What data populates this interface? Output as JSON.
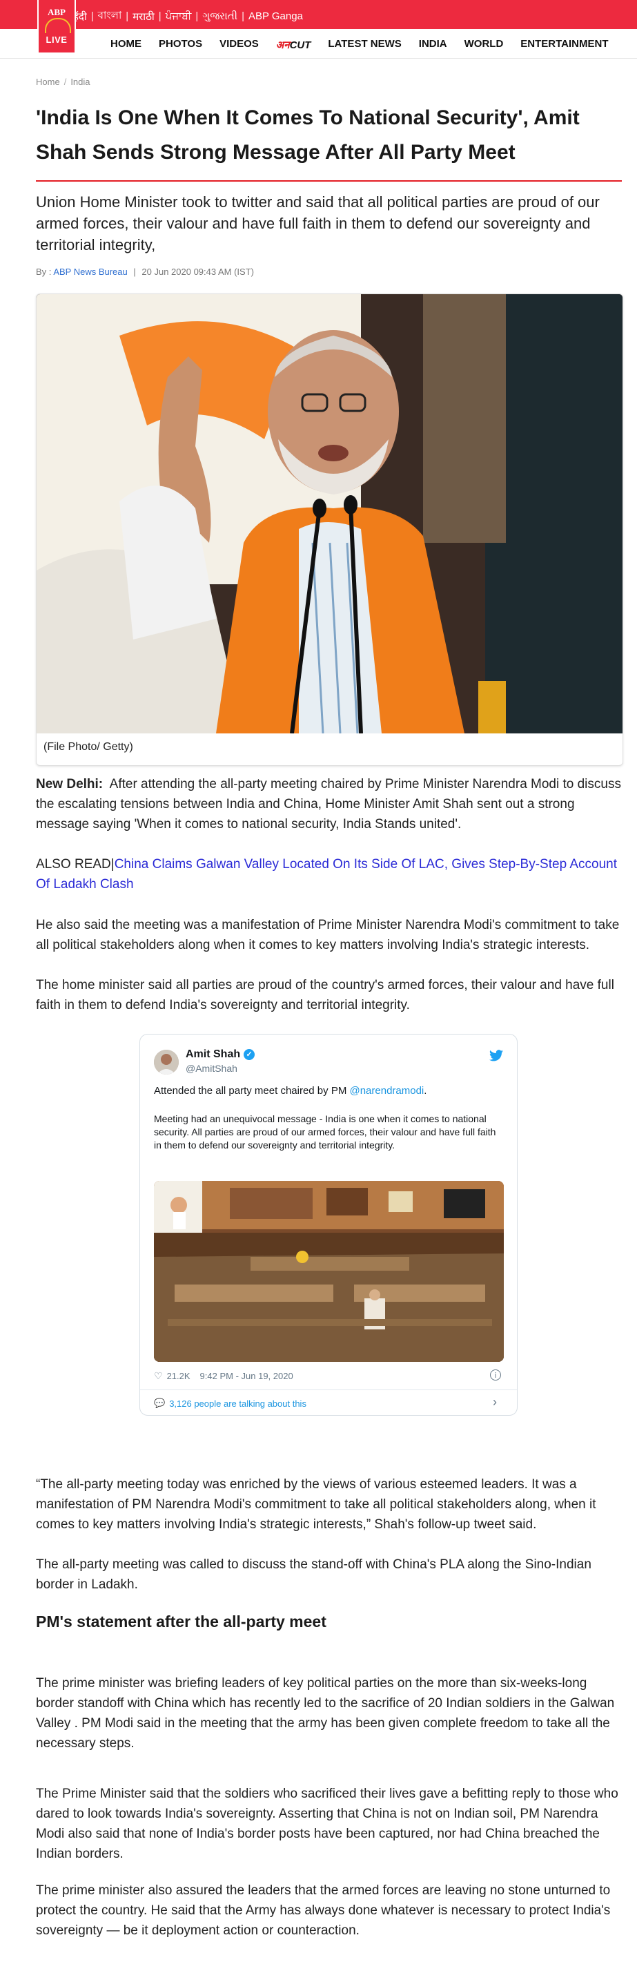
{
  "topbar": {
    "languages": [
      "हिंदी",
      "বাংলা",
      "मराठी",
      "ਪੰਜਾਬੀ",
      "ગુજરાતી",
      "ABP Ganga"
    ],
    "logo": {
      "top": "ABP",
      "bottom": "LIVE"
    }
  },
  "nav": {
    "items": [
      "HOME",
      "PHOTOS",
      "VIDEOS"
    ],
    "brand": {
      "prefix": "अन",
      "suffix": "CUT"
    },
    "items_after": [
      "LATEST NEWS",
      "INDIA",
      "WORLD",
      "ENTERTAINMENT"
    ]
  },
  "breadcrumb": {
    "home": "Home",
    "separator": "/",
    "current": "India"
  },
  "article": {
    "headline": "'India Is One When It Comes To National Security', Amit Shah Sends Strong Message After All Party Meet",
    "standfirst": "Union Home Minister took to twitter and said that all political parties are proud of our armed forces, their valour and have full faith in them to defend our sovereignty and territorial integrity,",
    "byline": {
      "prefix": "By :",
      "author": "ABP News Bureau",
      "date": "20 Jun 2020 09:43 AM (IST)"
    },
    "photo_caption": "(File Photo/ Getty)",
    "p1": {
      "dateline": "New Delhi:",
      "text": "After attending the all-party meeting chaired by Prime Minister Narendra Modi to discuss the escalating tensions between India and China, Home Minister Amit Shah sent out a strong message saying 'When it comes to national security, India Stands united'."
    },
    "also_read": {
      "label": "ALSO READ|",
      "link_text": "China Claims Galwan Valley Located On Its Side Of LAC, Gives Step-By-Step Account Of Ladakh Clash"
    },
    "p2": "He also said the meeting was a manifestation of Prime Minister Narendra Modi's commitment to take all political stakeholders along when it comes to key matters involving India's strategic interests.",
    "p3": "The home minister said all parties are proud of the country's armed forces, their valour and have full faith in them to defend India's sovereignty and territorial integrity.",
    "p4": "“The all-party meeting today was enriched by the views of various esteemed leaders. It was a manifestation of PM Narendra Modi's commitment to take all political stakeholders along, when it comes to key matters involving India's strategic interests,” Shah's follow-up tweet said.",
    "p5": "The all-party meeting was called to discuss the stand-off with China's PLA along the Sino-Indian border in Ladakh.",
    "subheading": "PM's statement after the all-party meet",
    "p6": "The prime minister was briefing leaders of key political parties on the more than six-weeks-long border standoff with China which has recently led to the sacrifice of 20 Indian soldiers in the Galwan Valley . PM Modi said in the meeting that the army has been given complete freedom to take all the necessary steps.",
    "p7": "The Prime Minister said that the soldiers who sacrificed their lives gave a befitting reply to those who dared to look towards India's sovereignty. Asserting that China is not on Indian soil, PM Narendra Modi also said that none of India's border posts have been captured, nor had China breached the Indian borders.",
    "p8": "The prime minister also assured the leaders that the armed forces are leaving no stone unturned to protect the country.  He said that the Army has always done whatever is necessary to protect India's sovereignty — be it deployment action or counteraction."
  },
  "tweet": {
    "name": "Amit Shah",
    "handle": "@AmitShah",
    "line1_prefix": "Attended the all party meet chaired by PM ",
    "line1_mention": "@narendramodi",
    "line1_suffix": ".",
    "message": "Meeting had an unequivocal message - India is one when it comes to national security. All parties are proud of our armed forces, their valour and have full faith in them to defend our sovereignty and territorial integrity.",
    "likes": "21.2K",
    "time": "9:42 PM - Jun 19, 2020",
    "talking": "3,126 people are talking about this"
  },
  "colors": {
    "brand_red": "#ed2a3f",
    "headline_rule": "#e31b23",
    "link_blue": "#2b2bd6",
    "twitter_blue": "#1da1f2"
  }
}
